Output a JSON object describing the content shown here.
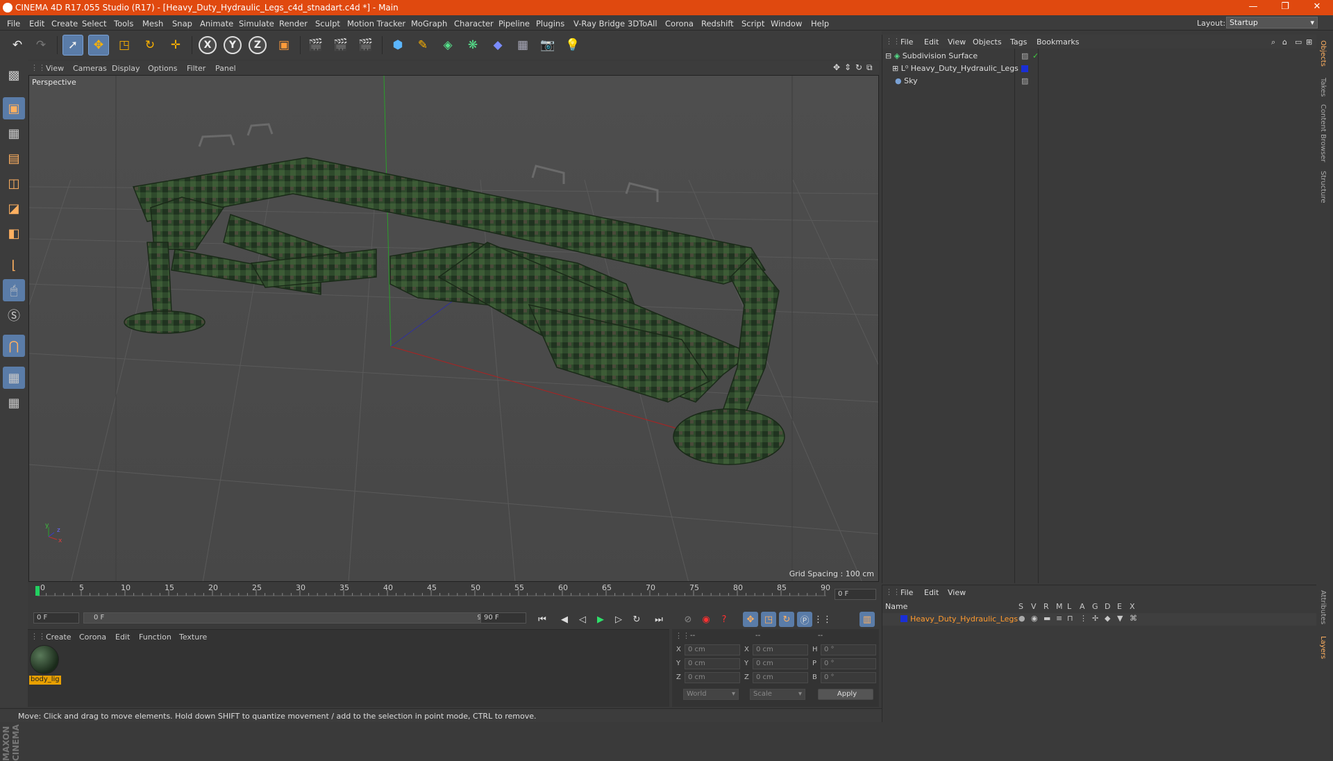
{
  "window": {
    "title": "CINEMA 4D R17.055 Studio (R17) - [Heavy_Duty_Hydraulic_Legs_c4d_stnadart.c4d *] - Main",
    "minimize": "—",
    "maximize": "❐",
    "close": "✕"
  },
  "menubar": {
    "items": [
      "File",
      "Edit",
      "Create",
      "Select",
      "Tools",
      "Mesh",
      "Snap",
      "Animate",
      "Simulate",
      "Render",
      "Sculpt",
      "Motion Tracker",
      "MoGraph",
      "Character",
      "Pipeline",
      "Plugins",
      "V-Ray Bridge",
      "3DToAll",
      "Corona",
      "Redshift",
      "Script",
      "Window",
      "Help"
    ],
    "layout_label": "Layout:",
    "layout_value": "Startup"
  },
  "toolbar": {
    "axis_x": "X",
    "axis_y": "Y",
    "axis_z": "Z"
  },
  "viewport": {
    "menu": [
      "View",
      "Cameras",
      "Display",
      "Options",
      "Filter",
      "Panel"
    ],
    "camera_label": "Perspective",
    "grid_spacing": "Grid Spacing : 100 cm",
    "axis_y": "y",
    "axis_z": "z",
    "axis_x": "x"
  },
  "timeline": {
    "ticks": [
      "0",
      "5",
      "10",
      "15",
      "20",
      "25",
      "30",
      "35",
      "40",
      "45",
      "50",
      "55",
      "60",
      "65",
      "70",
      "75",
      "80",
      "85",
      "90"
    ],
    "current_frame": "0 F",
    "start_frame": "0 F",
    "range_start": "0 F",
    "range_end": "90 F",
    "end_frame": "90 F"
  },
  "material_panel": {
    "menu": [
      "Create",
      "Corona",
      "Edit",
      "Function",
      "Texture"
    ],
    "material_name": "body_lig"
  },
  "coords": {
    "header": [
      "--",
      "--",
      "--"
    ],
    "rows": [
      {
        "l1": "X",
        "v1": "0 cm",
        "l2": "X",
        "v2": "0 cm",
        "l3": "H",
        "v3": "0 °"
      },
      {
        "l1": "Y",
        "v1": "0 cm",
        "l2": "Y",
        "v2": "0 cm",
        "l3": "P",
        "v3": "0 °"
      },
      {
        "l1": "Z",
        "v1": "0 cm",
        "l2": "Z",
        "v2": "0 cm",
        "l3": "B",
        "v3": "0 °"
      }
    ],
    "world": "World",
    "scale": "Scale",
    "apply": "Apply"
  },
  "status": "Move: Click and drag to move elements. Hold down SHIFT to quantize movement / add to the selection in point mode, CTRL to remove.",
  "objects_panel": {
    "menu": [
      "File",
      "Edit",
      "View",
      "Objects",
      "Tags",
      "Bookmarks"
    ],
    "items": [
      "Subdivision Surface",
      "Heavy_Duty_Hydraulic_Legs",
      "Sky"
    ]
  },
  "layers_panel": {
    "menu": [
      "File",
      "Edit",
      "View"
    ],
    "name_header": "Name",
    "columns": [
      "S",
      "V",
      "R",
      "M",
      "L",
      "A",
      "G",
      "D",
      "E",
      "X"
    ],
    "layer_name": "Heavy_Duty_Hydraulic_Legs",
    "layer_color": "#1a2fd6"
  },
  "side_tabs": [
    "Objects",
    "Takes",
    "Content Browser",
    "Structure",
    "Attributes",
    "Layers"
  ],
  "maxon_logo": "MAXON CINEMA 4D",
  "colors": {
    "title_bar": "#e0490f",
    "accent_blue": "#5a7ca8",
    "material_highlight": "#e8a000"
  }
}
